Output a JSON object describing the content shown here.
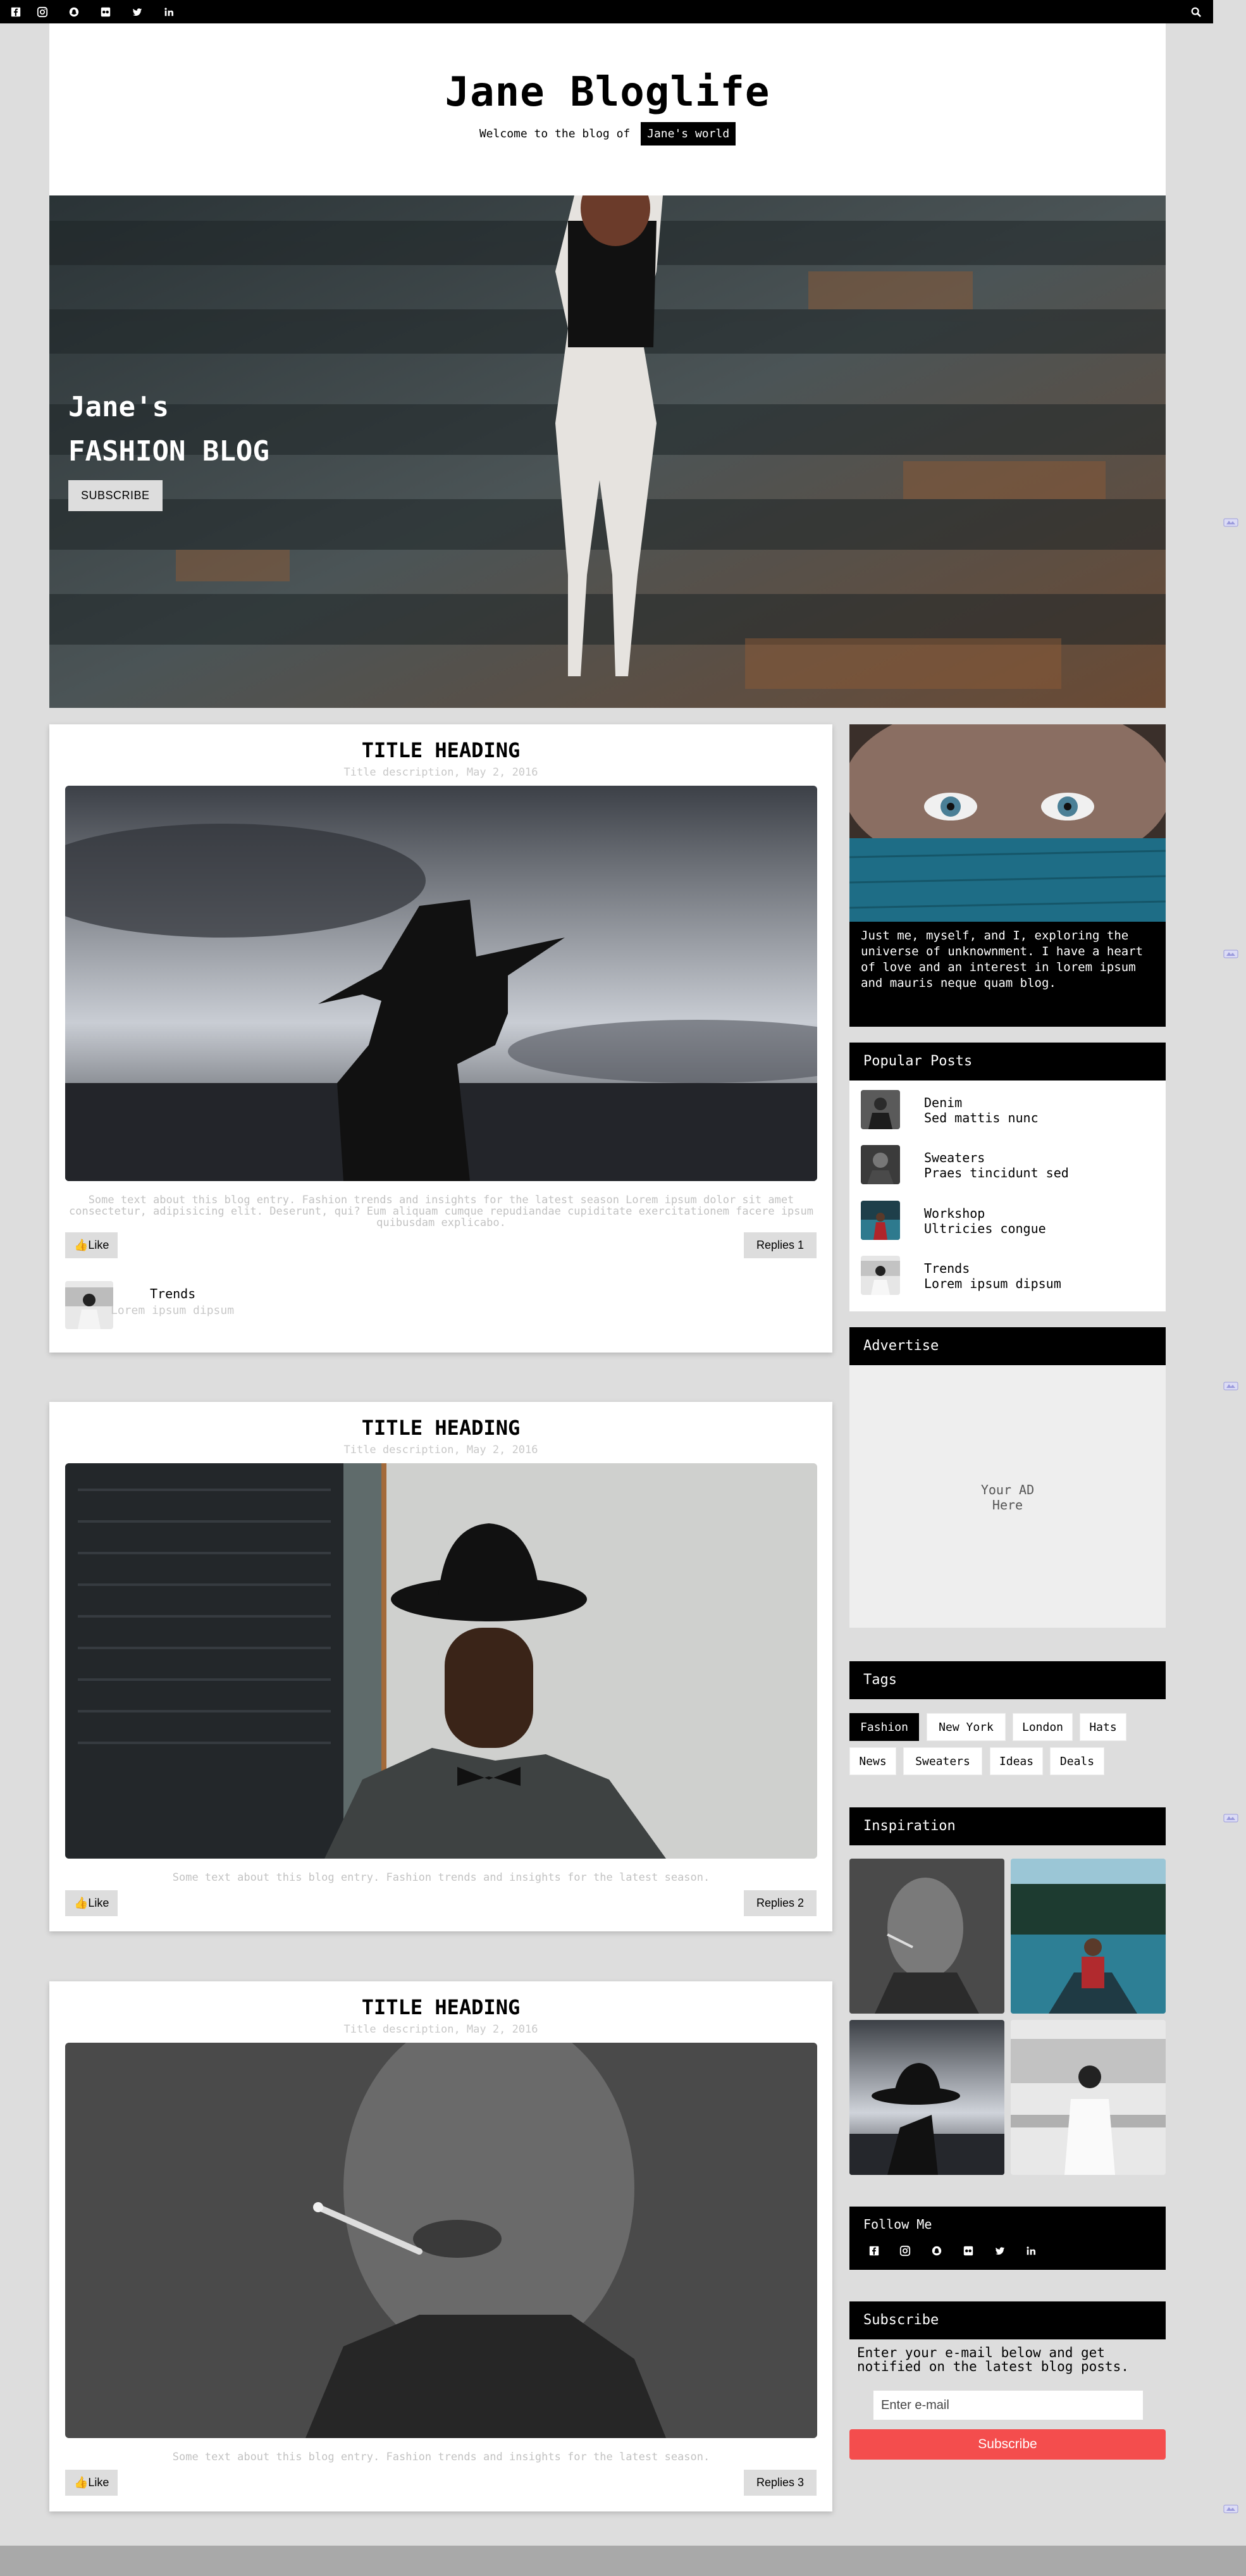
{
  "nav": {
    "social_icons": [
      "facebook-icon",
      "instagram-icon",
      "snapchat-icon",
      "flickr-icon",
      "twitter-icon",
      "linkedin-icon"
    ],
    "search_icon": "search-icon"
  },
  "masthead": {
    "title": "Jane Bloglife",
    "tagline": "Welcome to the blog of",
    "badge": "Jane's world"
  },
  "hero": {
    "line1": "Jane's",
    "line2": "FASHION BLOG",
    "button": "SUBSCRIBE"
  },
  "posts": [
    {
      "title": "TITLE HEADING",
      "description": "Title description, May 2, 2016",
      "text": "Some text about this blog entry. Fashion trends and insights for the latest season Lorem ipsum dolor sit amet consectetur, adipisicing elit. Deserunt, qui? Eum aliquam cumque repudiandae cupiditate exercitationem facere ipsum quibusdam explicabo.",
      "like": "Like",
      "replies": "Replies 1",
      "reply": {
        "name": "Trends",
        "text": "Lorem ipsum dipsum"
      }
    },
    {
      "title": "TITLE HEADING",
      "description": "Title description, May 2, 2016",
      "text": "Some text about this blog entry. Fashion trends and insights for the latest season.",
      "like": "Like",
      "replies": "Replies 2"
    },
    {
      "title": "TITLE HEADING",
      "description": "Title description, May 2, 2016",
      "text": "Some text about this blog entry. Fashion trends and insights for the latest season.",
      "like": "Like",
      "replies": "Replies 3"
    }
  ],
  "about": {
    "text": "Just me, myself, and I, exploring the universe of unknownment. I have a heart of love and an interest in lorem ipsum and mauris neque quam blog."
  },
  "popular": {
    "heading": "Popular Posts",
    "items": [
      {
        "title": "Denim",
        "sub": "Sed mattis nunc"
      },
      {
        "title": "Sweaters",
        "sub": "Praes tincidunt sed"
      },
      {
        "title": "Workshop",
        "sub": "Ultricies congue"
      },
      {
        "title": "Trends",
        "sub": "Lorem ipsum dipsum"
      }
    ]
  },
  "advertise": {
    "heading": "Advertise",
    "line1": "Your AD",
    "line2": "Here"
  },
  "tags": {
    "heading": "Tags",
    "items": [
      "Fashion",
      "New York",
      "London",
      "Hats",
      "News",
      "Sweaters",
      "Ideas",
      "Deals"
    ],
    "active": "Fashion"
  },
  "inspiration": {
    "heading": "Inspiration"
  },
  "follow": {
    "heading": "Follow Me"
  },
  "subscribe": {
    "heading": "Subscribe",
    "description": "Enter your e-mail below and get notified on the latest blog posts.",
    "placeholder": "Enter e-mail",
    "button": "Subscribe"
  },
  "colors": {
    "accent": "#f44d4d",
    "dark": "#000000",
    "page_bg": "#dddddd"
  }
}
